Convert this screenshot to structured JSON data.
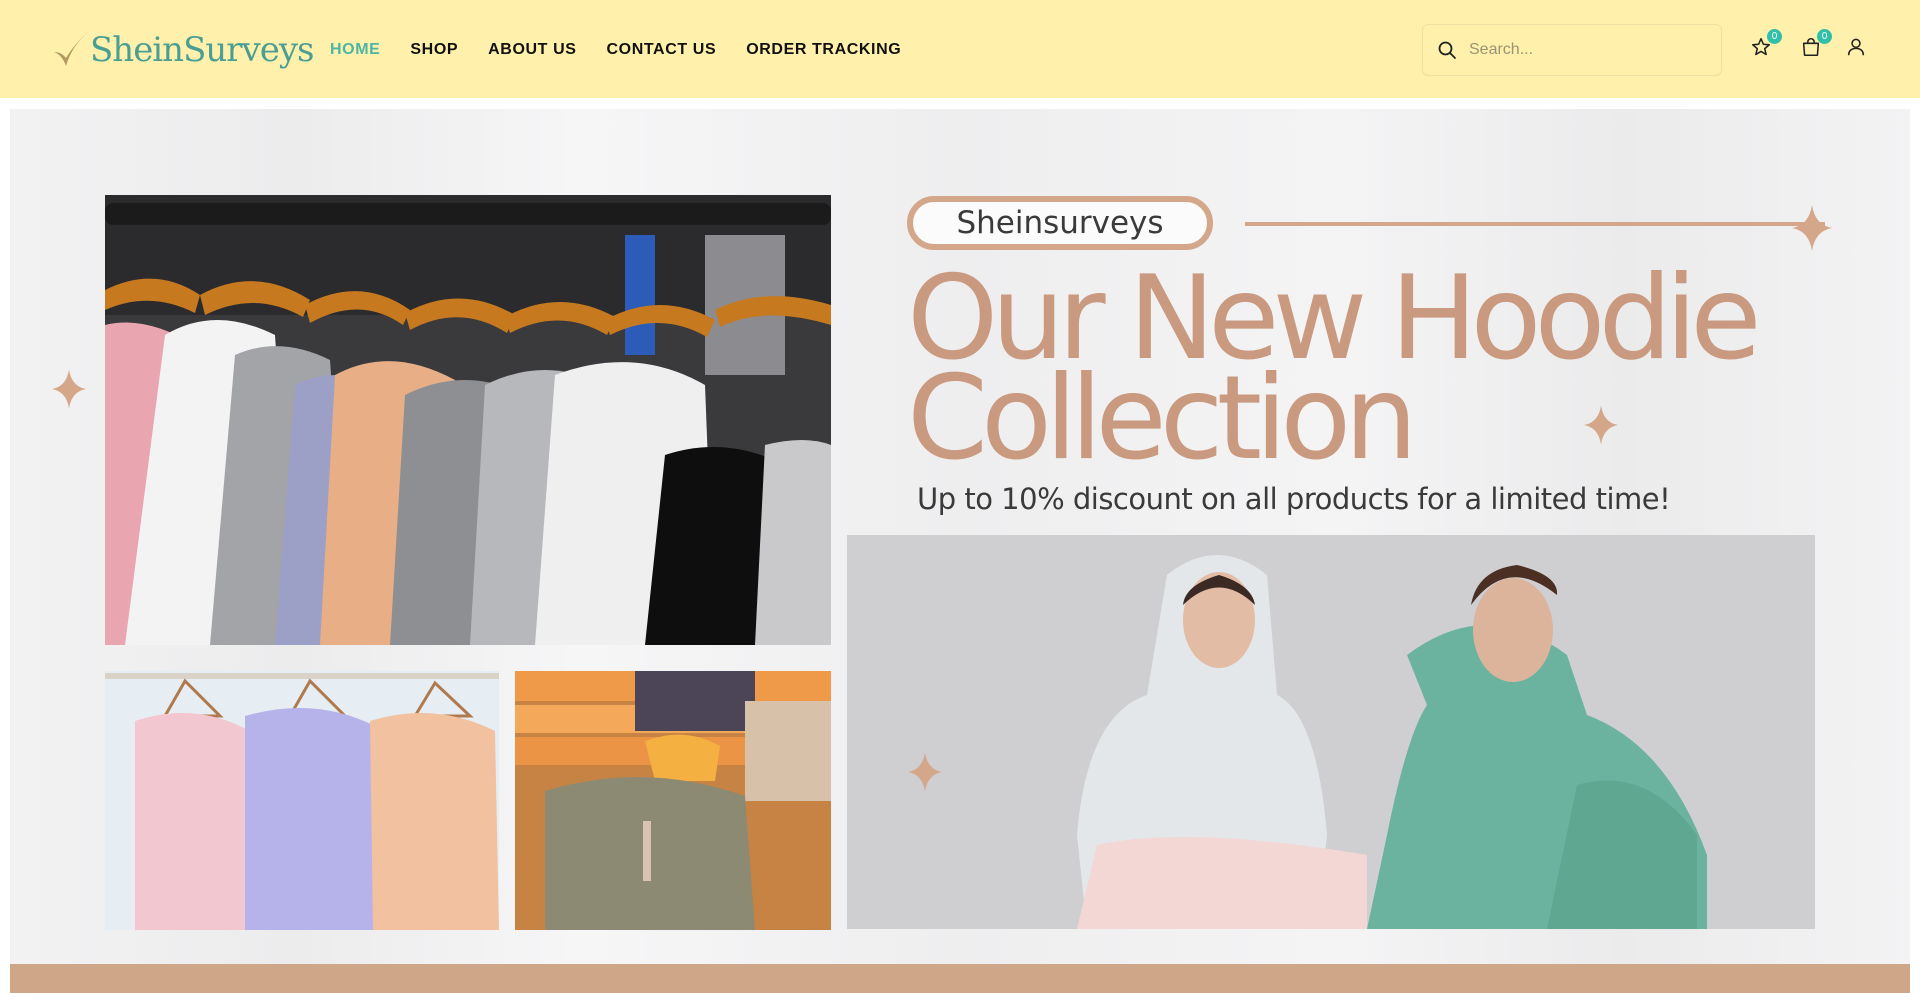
{
  "brand": {
    "name": "SheinSurveys",
    "logo_icon": "checkmark-icon",
    "color": "#4b9e93"
  },
  "nav": {
    "items": [
      {
        "label": "HOME",
        "active": true
      },
      {
        "label": "SHOP",
        "active": false
      },
      {
        "label": "ABOUT US",
        "active": false
      },
      {
        "label": "CONTACT US",
        "active": false
      },
      {
        "label": "ORDER TRACKING",
        "active": false
      }
    ],
    "active_color": "#4cb5a4"
  },
  "search": {
    "placeholder": "Search...",
    "value": "",
    "icon": "search-icon"
  },
  "header_icons": {
    "wishlist": {
      "icon": "star-icon",
      "count": "0"
    },
    "cart": {
      "icon": "bag-icon",
      "count": "0"
    },
    "account": {
      "icon": "user-icon"
    }
  },
  "banner": {
    "pill_label": "Sheinsurveys",
    "headline_line1": "Our New Hoodie",
    "headline_line2": "Collection",
    "subline": "Up to 10% discount on all products for a limited time!",
    "accent_color": "#c99a80"
  },
  "colors": {
    "header_bg": "#fff1ac",
    "badge": "#32bfa9",
    "strip": "#cfa688"
  }
}
